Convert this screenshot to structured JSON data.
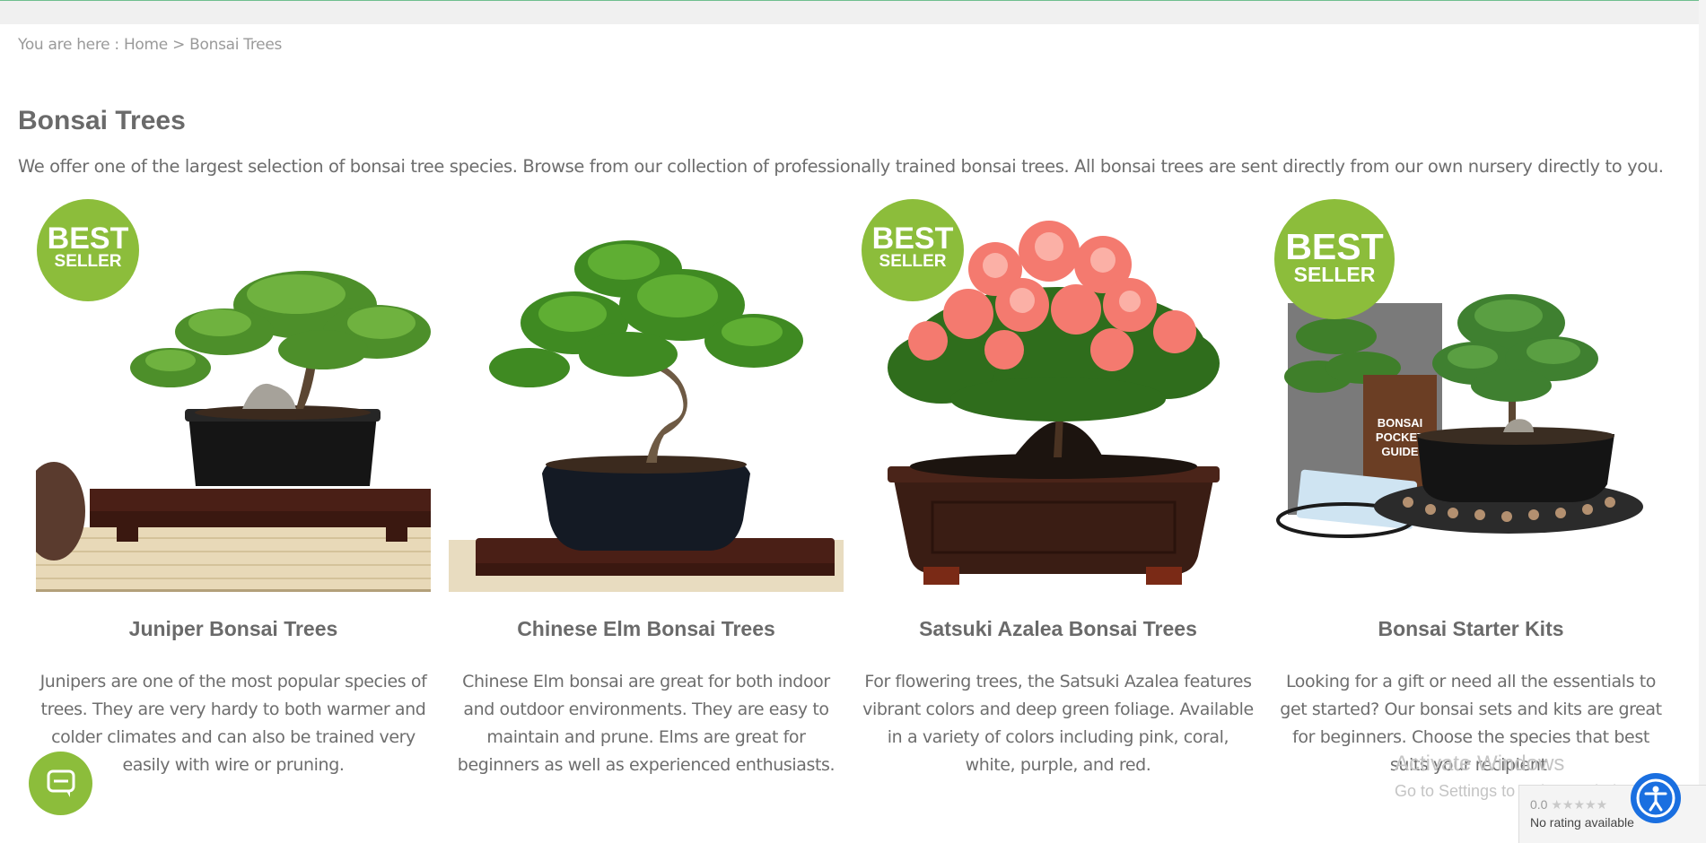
{
  "breadcrumb": {
    "prefix": "You are here : ",
    "home": "Home",
    "separator": " > ",
    "current": "Bonsai Trees"
  },
  "page": {
    "title": "Bonsai Trees",
    "intro": "We offer one of the largest selection of bonsai tree species. Browse from our collection of professionally trained bonsai trees. All bonsai trees are sent directly from our own nursery directly to you."
  },
  "badge": {
    "line1": "BEST",
    "line2": "SELLER"
  },
  "categories": [
    {
      "title": "Juniper Bonsai Trees",
      "description": "Junipers are one of the most popular species of trees. They are very hardy to both warmer and colder climates and can also be trained very easily with wire or pruning.",
      "best_seller": true
    },
    {
      "title": "Chinese Elm Bonsai Trees",
      "description": "Chinese Elm bonsai are great for both indoor and outdoor environments. They are easy to maintain and prune. Elms are great for beginners as well as experienced enthusiasts.",
      "best_seller": false
    },
    {
      "title": "Satsuki Azalea Bonsai Trees",
      "description": "For flowering trees, the Satsuki Azalea features vibrant colors and deep green foliage. Available in a variety of colors including pink, coral, white, purple, and red.",
      "best_seller": true
    },
    {
      "title": "Bonsai Starter Kits",
      "description": "Looking for a gift or need all the essentials to get started? Our bonsai sets and kits are great for beginners. Choose the species that best suits your recipient.",
      "best_seller": true,
      "book_label": [
        "BONSAI",
        "POCKET",
        "GUIDE"
      ]
    }
  ],
  "chat": {
    "icon": "chat-bubble-icon"
  },
  "accessibility": {
    "icon": "accessibility-person-icon"
  },
  "watermark": {
    "line1": "Activate Windows",
    "line2": "Go to Settings to activate Windows."
  },
  "rating_widget": {
    "score": "0.0",
    "stars": "★★★★★",
    "status": "No rating available"
  },
  "colors": {
    "accent_green": "#8cbd3b",
    "accessibility_blue": "#1a6fe0",
    "text_gray": "#6d6d6d"
  }
}
